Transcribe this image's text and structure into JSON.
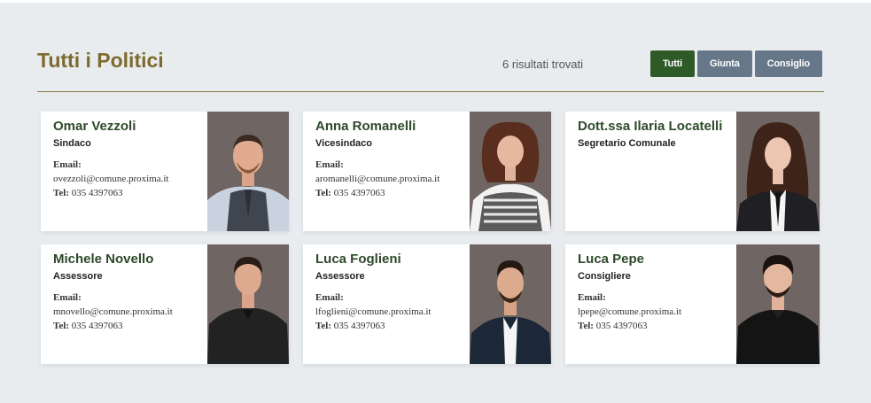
{
  "header": {
    "title": "Tutti i Politici",
    "results": "6 risultati trovati"
  },
  "filters": [
    {
      "label": "Tutti",
      "active": true
    },
    {
      "label": "Giunta",
      "active": false
    },
    {
      "label": "Consiglio",
      "active": false
    }
  ],
  "labels": {
    "email": "Email:",
    "tel": "Tel:"
  },
  "people": [
    {
      "name": "Omar Vezzoli",
      "role": "Sindaco",
      "email": "ovezzoli@comune.proxima.it",
      "tel": "035 4397063"
    },
    {
      "name": "Anna Romanelli",
      "role": "Vicesindaco",
      "email": "aromanelli@comune.proxima.it",
      "tel": "035 4397063"
    },
    {
      "name": "Dott.ssa Ilaria Locatelli",
      "role": "Segretario Comunale",
      "email": "",
      "tel": ""
    },
    {
      "name": "Michele Novello",
      "role": "Assessore",
      "email": "mnovello@comune.proxima.it",
      "tel": "035 4397063"
    },
    {
      "name": "Luca Foglieni",
      "role": "Assessore",
      "email": "lfoglieni@comune.proxima.it",
      "tel": "035 4397063"
    },
    {
      "name": "Luca Pepe",
      "role": "Consigliere",
      "email": "lpepe@comune.proxima.it",
      "tel": "035 4397063"
    }
  ],
  "colors": {
    "title": "#7d6a2e",
    "name": "#2d4a2a",
    "active_filter": "#2d5a27",
    "inactive_filter": "#667789",
    "photo_bg": "#6e6462"
  }
}
